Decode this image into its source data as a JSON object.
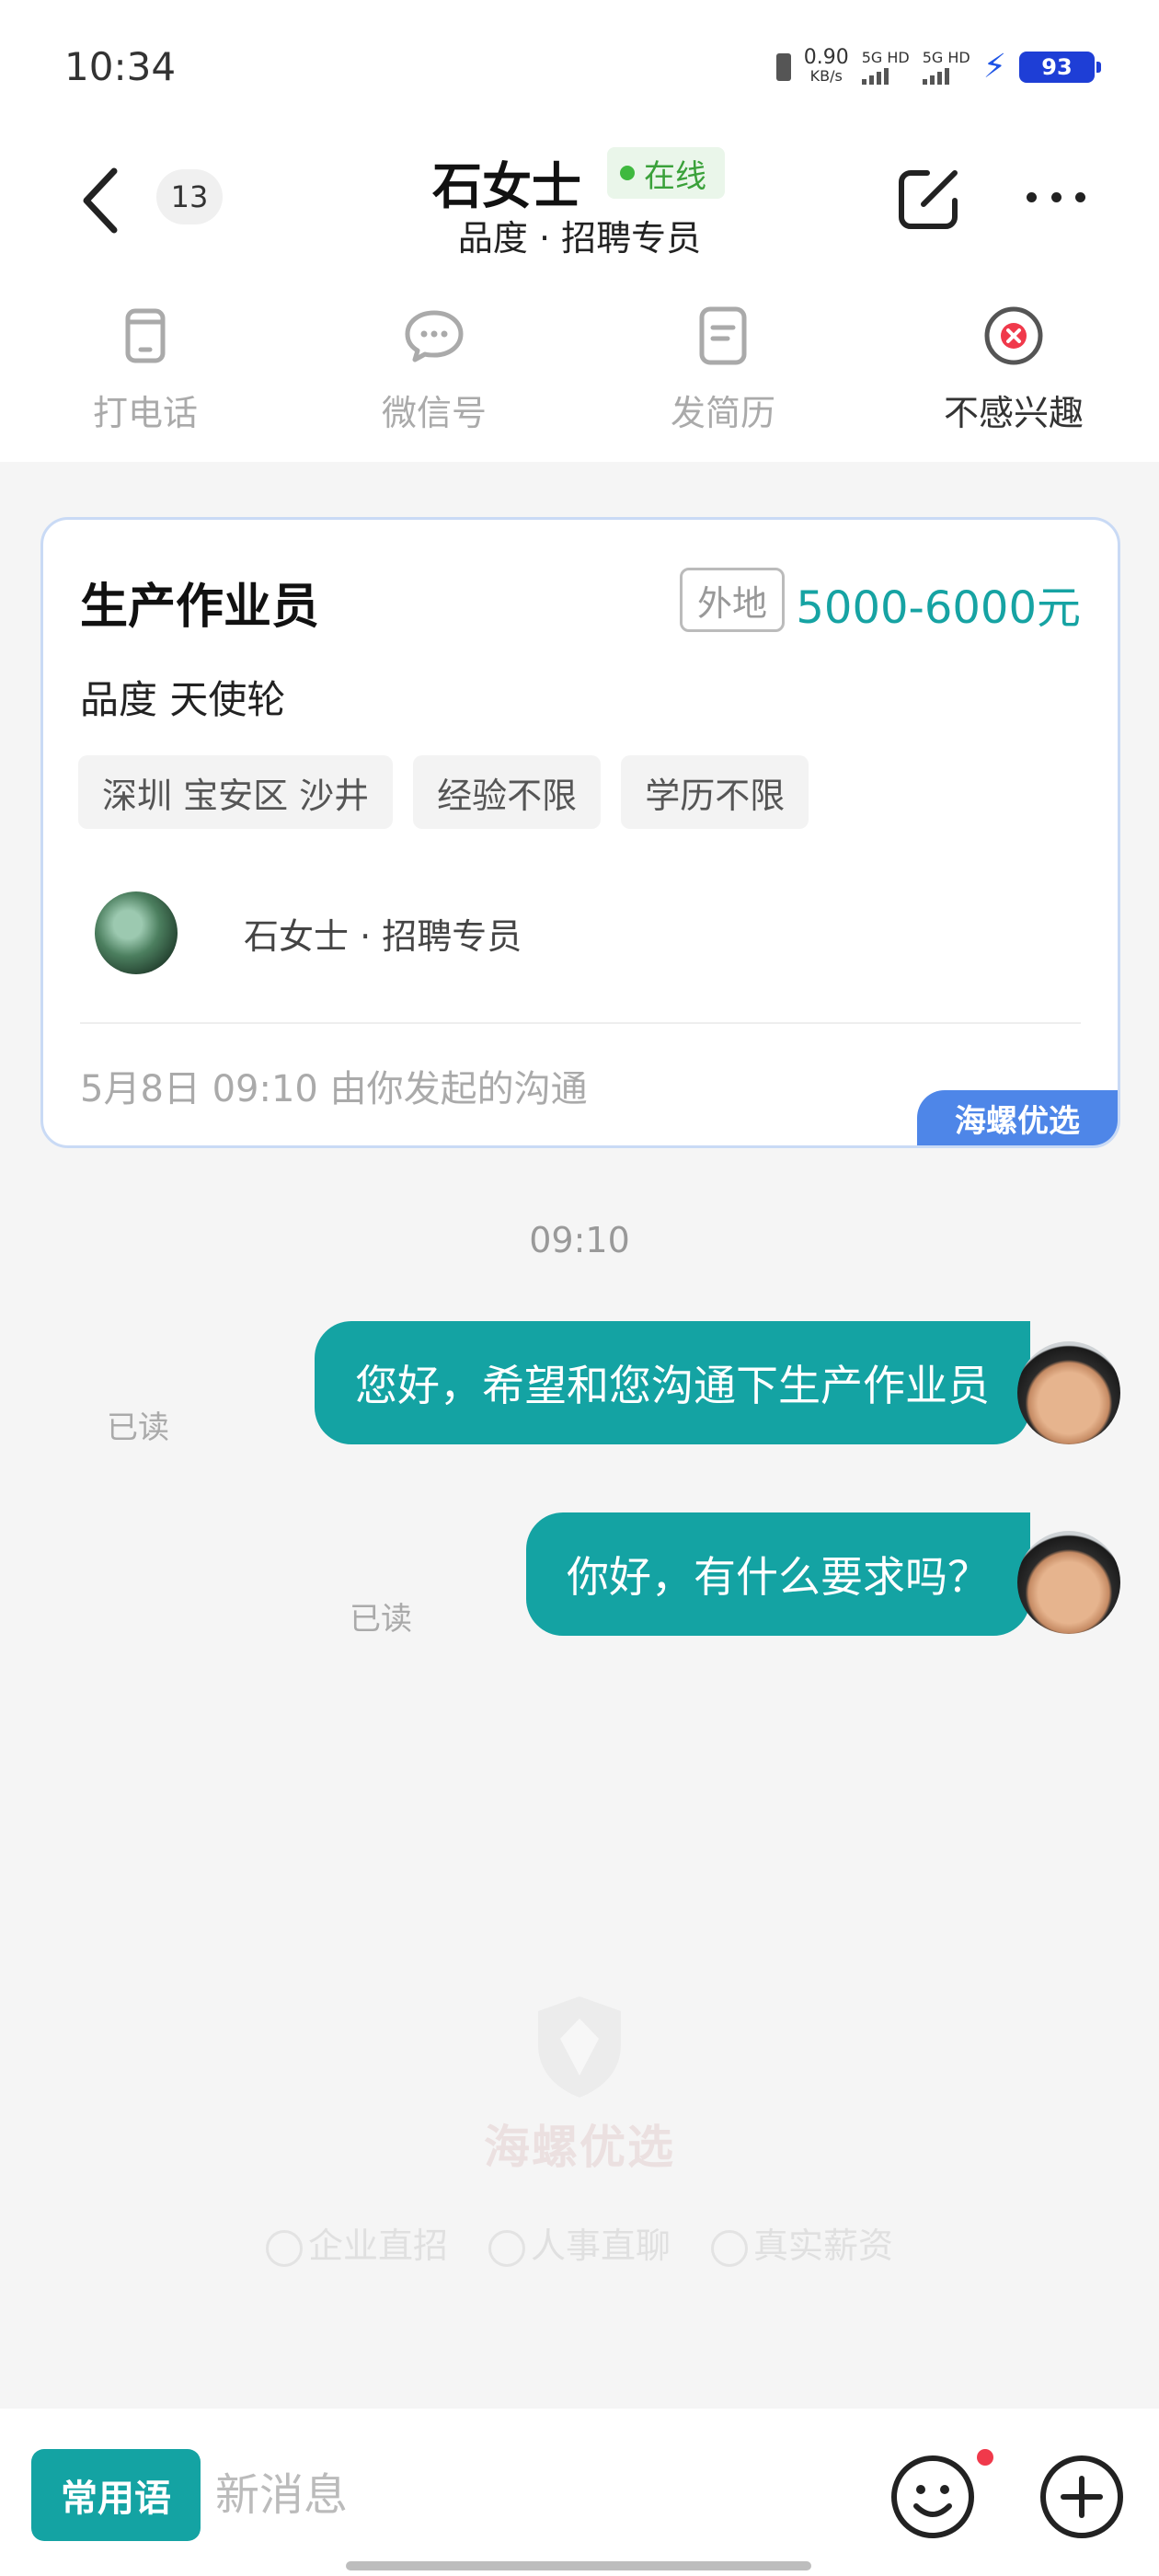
{
  "status_bar": {
    "time": "10:34",
    "net_speed_value": "0.90",
    "net_speed_unit": "KB/s",
    "sim1_label": "5G HD",
    "sim2_label": "5G HD",
    "battery": "93",
    "battery_color": "#1e3ed6"
  },
  "header": {
    "unread_count": "13",
    "contact_name": "石女士",
    "online_status": "在线",
    "subtitle": "品度 · 招聘专员"
  },
  "actions": [
    {
      "label": "打电话",
      "icon": "phone-icon"
    },
    {
      "label": "微信号",
      "icon": "wechat-icon"
    },
    {
      "label": "发简历",
      "icon": "resume-icon"
    },
    {
      "label": "不感兴趣",
      "icon": "not-interested-icon"
    }
  ],
  "job_card": {
    "title": "生产作业员",
    "remote_tag": "外地",
    "salary": "5000-6000元",
    "company": "品度  天使轮",
    "tags": [
      "深圳 宝安区 沙井",
      "经验不限",
      "学历不限"
    ],
    "recruiter": "石女士 · 招聘专员",
    "started": "5月8日 09:10 由你发起的沟通",
    "brand": "海螺优选"
  },
  "chat": {
    "time_separator": "09:10",
    "messages": [
      {
        "text": "您好，希望和您沟通下生产作业员",
        "status": "已读"
      },
      {
        "text": "你好，有什么要求吗？",
        "status": "已读"
      }
    ]
  },
  "watermark": {
    "brand": "海螺优选",
    "features": [
      "企业直招",
      "人事直聊",
      "真实薪资"
    ]
  },
  "input_bar": {
    "phrases_label": "常用语",
    "placeholder": "新消息"
  },
  "colors": {
    "accent": "#14a3a3",
    "online": "#3fb93f",
    "brand_ribbon": "#4e86e8"
  }
}
